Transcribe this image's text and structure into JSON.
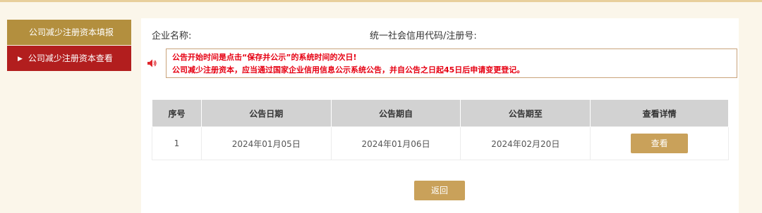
{
  "sidebar": {
    "items": [
      {
        "label": "公司减少注册资本填报"
      },
      {
        "label": "公司减少注册资本查看",
        "marker": "▶"
      }
    ]
  },
  "header": {
    "company_name_label": "企业名称:",
    "credit_code_label": "统一社会信用代码/注册号:"
  },
  "notice": {
    "line1": "公告开始时间是点击“保存并公示”的系统时间的次日!",
    "line2": "公司减少注册资本，应当通过国家企业信用信息公示系统公告，并自公告之日起45日后申请变更登记。"
  },
  "table": {
    "headers": [
      "序号",
      "公告日期",
      "公告期自",
      "公告期至",
      "查看详情"
    ],
    "rows": [
      {
        "index": "1",
        "announce_date": "2024年01月05日",
        "period_from": "2024年01月06日",
        "period_to": "2024年02月20日",
        "action_label": "查看"
      }
    ]
  },
  "buttons": {
    "back_label": "返回"
  },
  "colors": {
    "page_bg": "#fbf6ea",
    "sidebar_fill": "#b38f3e",
    "sidebar_active": "#b21e1e",
    "button": "#c9a15a",
    "notice_text": "#e60012",
    "table_header": "#d2d2d2"
  },
  "icons": {
    "notice": "speaker-icon",
    "sidebar_marker": "triangle-right-icon"
  }
}
